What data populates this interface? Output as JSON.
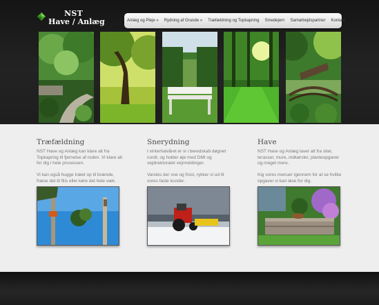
{
  "logo": {
    "line1": "NST",
    "line2": "Have / Anlæg"
  },
  "nav": [
    {
      "label": "Anlæg og Pleje »"
    },
    {
      "label": "Rydning af Grunde »"
    },
    {
      "label": "Træfældning og Topkapning"
    },
    {
      "label": "Smedejern"
    },
    {
      "label": "Samarbejdspartner"
    },
    {
      "label": "Kontakt"
    }
  ],
  "sections": [
    {
      "title": "Træfældning",
      "p1": "NST Have og Anlæg kan klare alt fra Topkapring til fjernelse af roden. Vi klare alt for dig i hele processen.",
      "p2": "Vi kan også hugge træet op til brænde, fræse det til fliis eller køre det hele væk."
    },
    {
      "title": "Snerydning",
      "p1": "I vinterhalvåret er vi i beredskab døgnet rundt, og holder øje med DMI og vejdirektoratet vejrmeldinger.",
      "p2": "Varsles der sne og frost, rykker vi ud til vores faste kunder."
    },
    {
      "title": "Have",
      "p1": "NST Have og Anlæg laver alt fra stier, terasser, mure, indkørsler, planteopgaver og meget mere.",
      "p2": "Kig vores menuer igennem for at se hvilke opgaver vi kan løse for dig."
    }
  ],
  "icons": {
    "logo": "leaf-icon"
  },
  "colors": {
    "accent_green": "#3f9e2a",
    "header_bg": "#1e1e1e",
    "content_bg": "#eeeeee"
  }
}
